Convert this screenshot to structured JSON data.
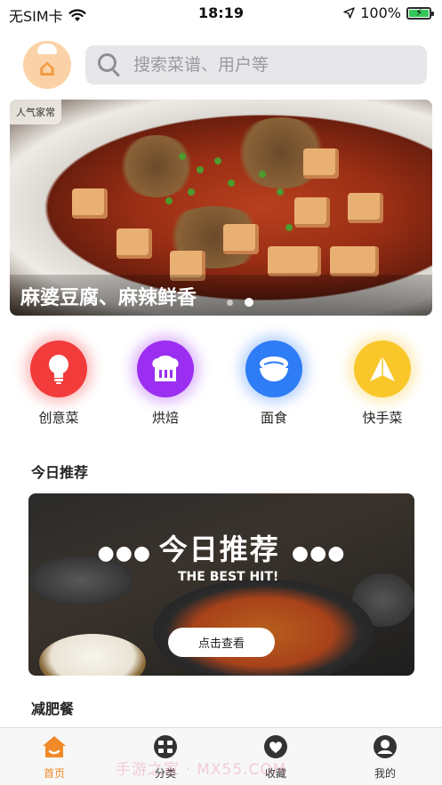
{
  "status_bar": {
    "carrier": "无SIM卡",
    "time": "18:19",
    "battery_percent": "100%",
    "battery_level": 1.0
  },
  "header": {
    "logo_icon": "chef-hat-logo-icon",
    "search_placeholder": "搜索菜谱、用户等"
  },
  "banner": {
    "tag": "人气家常",
    "caption": "麻婆豆腐、麻辣鲜香"
  },
  "categories": [
    {
      "label": "创意菜",
      "icon": "lightbulb-icon",
      "color": "#f23b3b"
    },
    {
      "label": "烘焙",
      "icon": "bread-icon",
      "color": "#9b2ef0"
    },
    {
      "label": "面食",
      "icon": "noodle-bowl-icon",
      "color": "#2e7cf6"
    },
    {
      "label": "快手菜",
      "icon": "paper-plane-icon",
      "color": "#f9c72a"
    }
  ],
  "sections": {
    "today_title": "今日推荐",
    "diet_title": "减肥餐"
  },
  "recommend_card": {
    "title": "今日推荐",
    "subtitle": "THE BEST HIT!",
    "button": "点击查看"
  },
  "tabbar": {
    "active_color": "#f08a28",
    "items": [
      {
        "label": "首页",
        "icon": "home-icon"
      },
      {
        "label": "分类",
        "icon": "category-icon"
      },
      {
        "label": "收藏",
        "icon": "heart-icon"
      },
      {
        "label": "我的",
        "icon": "user-icon"
      }
    ],
    "watermark": "手游之家 · MX55.COM"
  }
}
